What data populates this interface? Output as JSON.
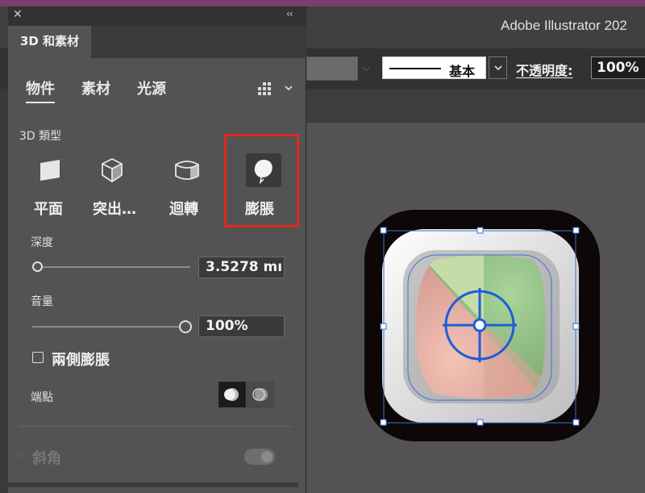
{
  "app": {
    "title": "Adobe Illustrator 202"
  },
  "control_bar": {
    "stroke_style_label": "基本",
    "opacity_label": "不透明度:",
    "opacity_value": "100%"
  },
  "panel": {
    "title": "3D 和素材",
    "close_glyph": "✕",
    "collapse_glyph": "‹‹",
    "tabs": [
      "物件",
      "素材",
      "光源"
    ],
    "active_tab": "物件",
    "section_3d_type": "3D 類型",
    "types": [
      {
        "label": "平面",
        "icon": "plane-icon"
      },
      {
        "label": "突出…",
        "icon": "extrude-icon"
      },
      {
        "label": "迴轉",
        "icon": "revolve-icon"
      },
      {
        "label": "膨脹",
        "icon": "inflate-icon",
        "selected": true
      }
    ],
    "depth_label": "深度",
    "depth_value": "3.5278 mı",
    "depth_fraction": 0.0,
    "volume_label": "音量",
    "volume_value": "100%",
    "volume_fraction": 1.0,
    "both_sides_label": "兩側膨脹",
    "both_sides_checked": false,
    "cap_label": "端點",
    "bevel_label": "斜角",
    "bevel_enabled": false
  },
  "colors": {
    "highlight": "#e0291e",
    "selection": "#3a6fd8",
    "panel_bg": "#535353"
  }
}
